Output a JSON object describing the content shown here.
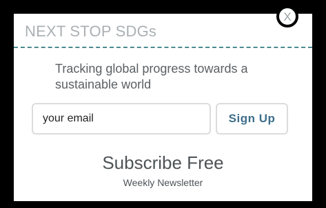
{
  "popup": {
    "title": "NEXT STOP SDGs",
    "close_label": "X",
    "tagline": "Tracking global progress towards a sustainable world",
    "email_placeholder": "your email",
    "signup_label": "Sign Up",
    "subscribe_title": "Subscribe Free",
    "subscribe_subtitle": "Weekly Newsletter"
  },
  "colors": {
    "frame": "#000000",
    "divider": "#4a8a8e",
    "button_text": "#3e6e8a"
  }
}
